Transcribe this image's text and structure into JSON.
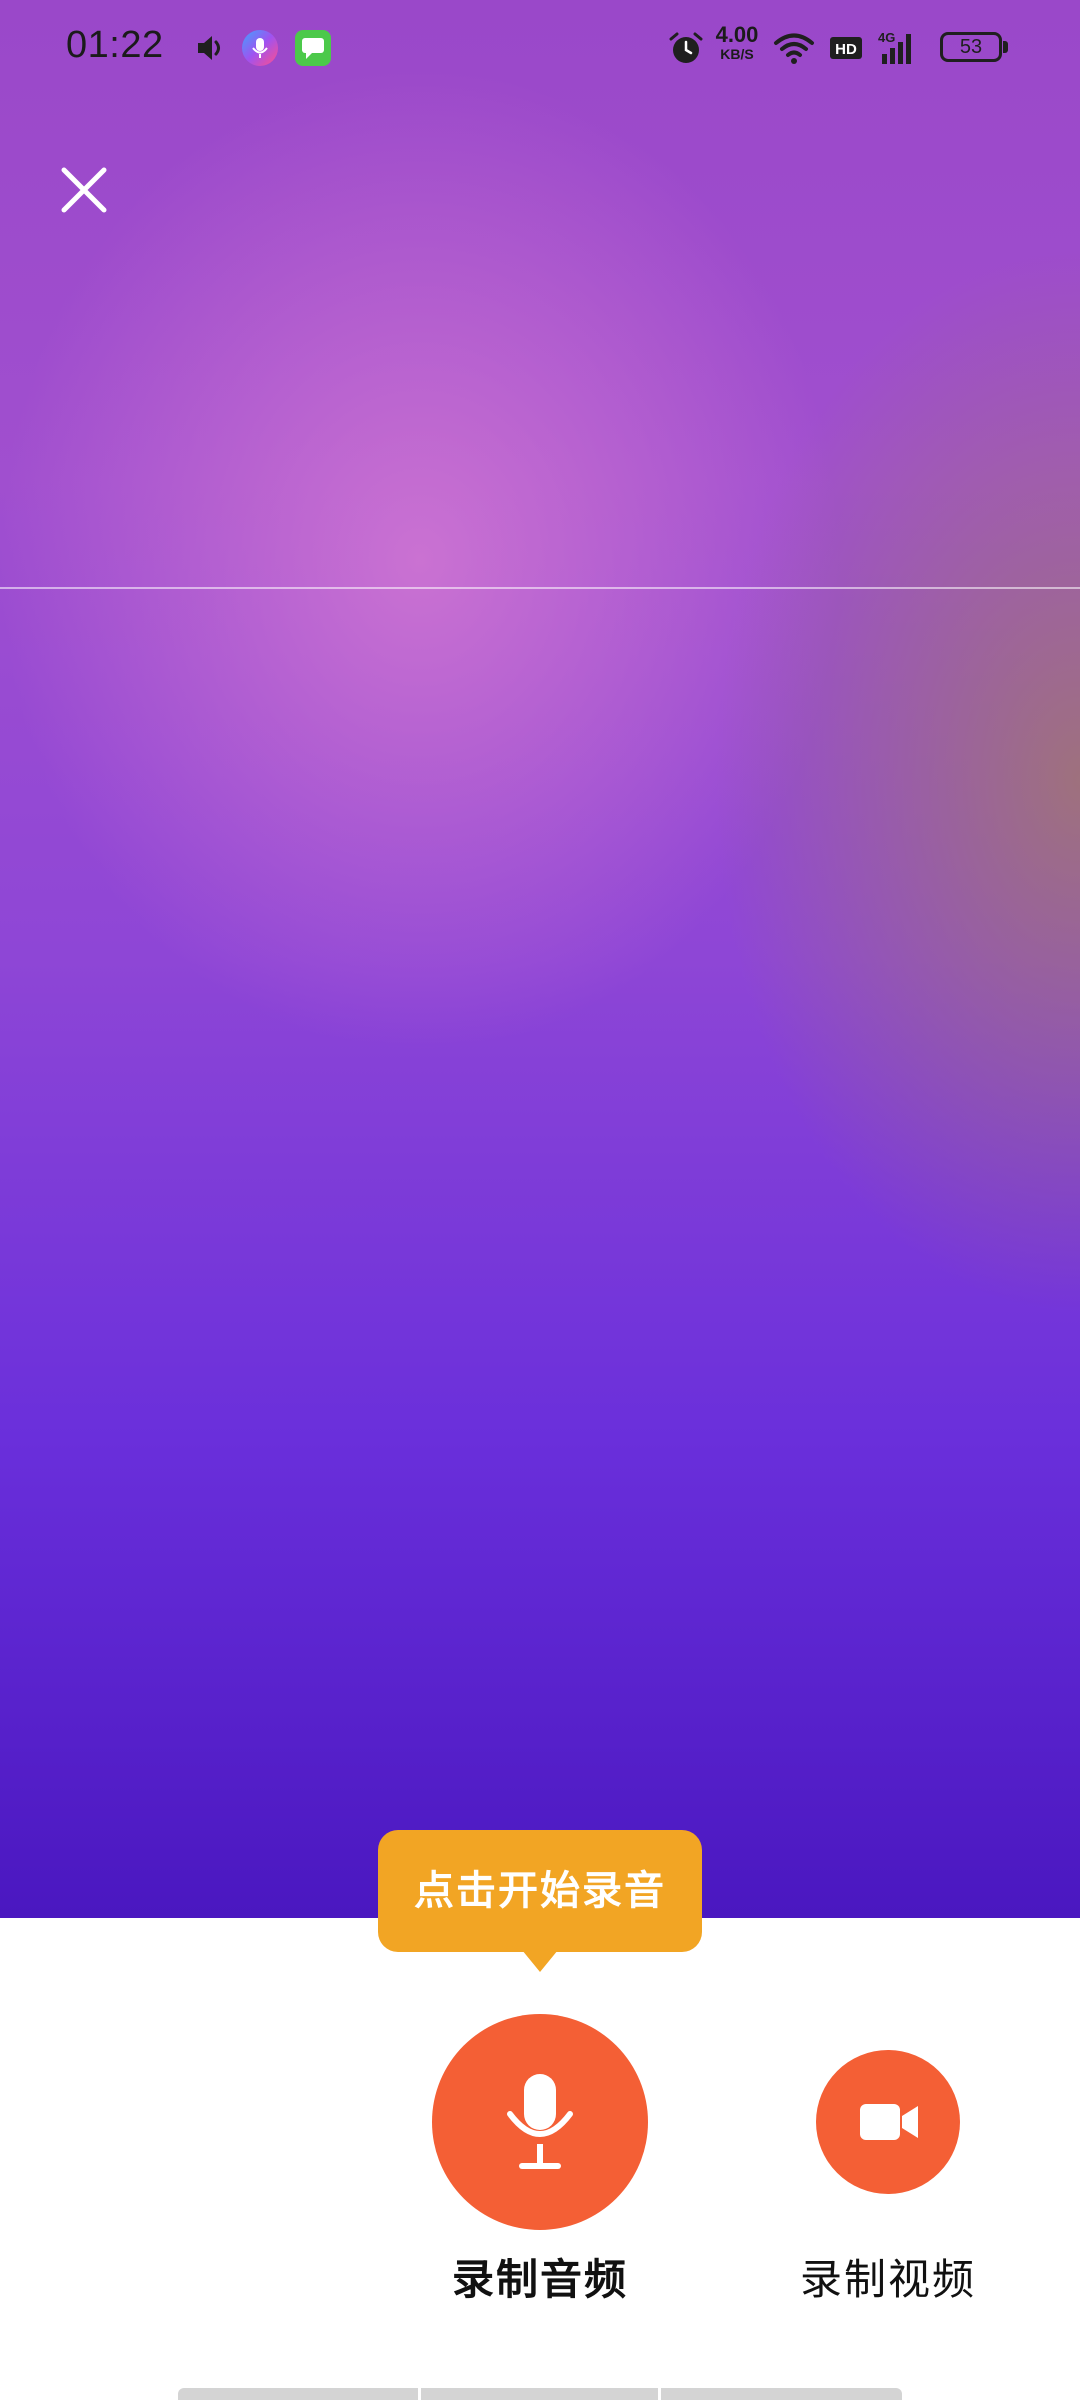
{
  "status_bar": {
    "time": "01:22",
    "net_speed_value": "4.00",
    "net_speed_unit": "KB/S",
    "hd_label": "HD",
    "network_label": "4G",
    "battery_level": "53",
    "icons": [
      "speaker-icon",
      "voice-recorder-app-icon",
      "message-app-icon",
      "alarm-icon",
      "wifi-icon",
      "hd-icon",
      "signal-4g-icon",
      "battery-icon"
    ]
  },
  "header": {
    "close_icon": "close-icon"
  },
  "tooltip": {
    "text": "点击开始录音"
  },
  "controls": {
    "record_audio_label": "录制音频",
    "record_audio_icon": "microphone-icon",
    "record_video_label": "录制视频",
    "record_video_icon": "video-camera-icon"
  },
  "colors": {
    "accent": "#f45f35",
    "tooltip": "#f2a524",
    "gradient_top": "#9a48c9",
    "gradient_bottom": "#4a17c0"
  }
}
